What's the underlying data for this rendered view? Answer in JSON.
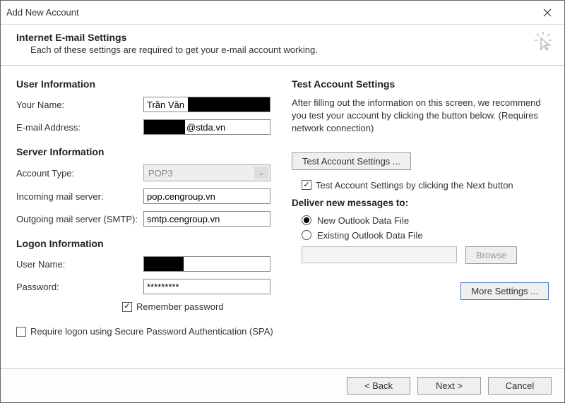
{
  "window": {
    "title": "Add New Account"
  },
  "header": {
    "title": "Internet E-mail Settings",
    "subtitle": "Each of these settings are required to get your e-mail account working."
  },
  "user_info": {
    "section": "User Information",
    "your_name_label": "Your Name:",
    "your_name_value": "Trần Văn",
    "email_label": "E-mail Address:",
    "email_value": "@stda.vn"
  },
  "server_info": {
    "section": "Server Information",
    "account_type_label": "Account Type:",
    "account_type_value": "POP3",
    "incoming_label": "Incoming mail server:",
    "incoming_value": "pop.cengroup.vn",
    "outgoing_label": "Outgoing mail server (SMTP):",
    "outgoing_value": "smtp.cengroup.vn"
  },
  "logon_info": {
    "section": "Logon Information",
    "username_label": "User Name:",
    "username_value": "",
    "password_label": "Password:",
    "password_value": "*********",
    "remember_label": "Remember password",
    "spa_label": "Require logon using Secure Password Authentication (SPA)"
  },
  "test": {
    "section": "Test Account Settings",
    "desc": "After filling out the information on this screen, we recommend you test your account by clicking the button below. (Requires network connection)",
    "btn_label": "Test Account Settings ...",
    "chk_next_label": "Test Account Settings by clicking the Next button"
  },
  "deliver": {
    "section": "Deliver new messages to:",
    "new_file": "New Outlook Data File",
    "existing_file": "Existing Outlook Data File",
    "browse": "Browse"
  },
  "more_settings": "More Settings ...",
  "footer": {
    "back": "< Back",
    "next": "Next >",
    "cancel": "Cancel"
  }
}
